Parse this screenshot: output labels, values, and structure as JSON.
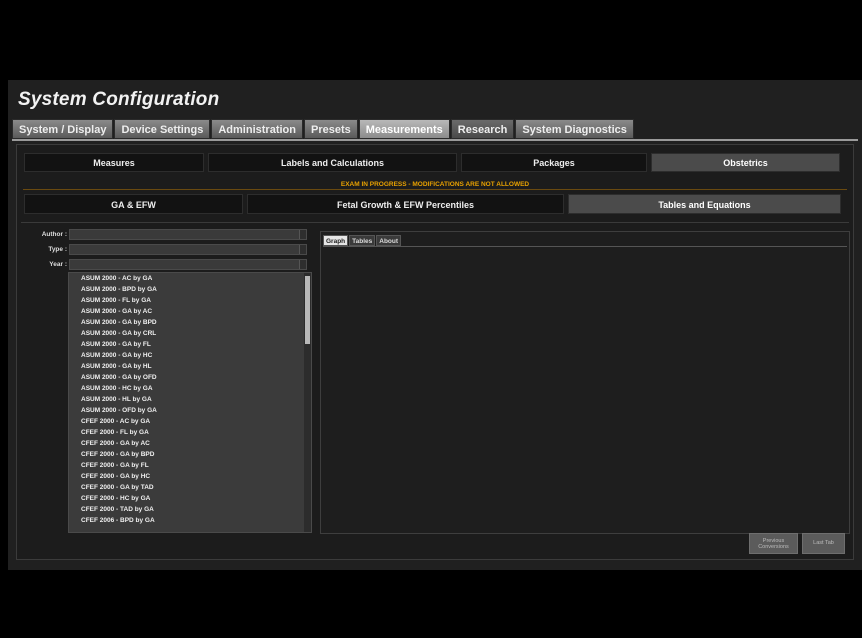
{
  "window": {
    "title": "System Configuration"
  },
  "main_tabs": [
    {
      "label": "System / Display"
    },
    {
      "label": "Device Settings"
    },
    {
      "label": "Administration"
    },
    {
      "label": "Presets"
    },
    {
      "label": "Measurements"
    },
    {
      "label": "Research"
    },
    {
      "label": "System Diagnostics"
    }
  ],
  "sub_tabs": [
    {
      "label": "Measures"
    },
    {
      "label": "Labels and Calculations"
    },
    {
      "label": "Packages"
    },
    {
      "label": "Obstetrics"
    }
  ],
  "warning": "EXAM IN PROGRESS - MODIFICATIONS ARE NOT ALLOWED",
  "ob_tabs": [
    {
      "label": "GA & EFW"
    },
    {
      "label": "Fetal Growth & EFW Percentiles"
    },
    {
      "label": "Tables and Equations"
    }
  ],
  "filters": {
    "author_label": "Author :",
    "type_label": "Type :",
    "year_label": "Year :"
  },
  "tables_list": [
    "ASUM 2000 - AC by GA",
    "ASUM 2000 - BPD by GA",
    "ASUM 2000 - FL by GA",
    "ASUM 2000 - GA by AC",
    "ASUM 2000 - GA by BPD",
    "ASUM 2000 - GA by CRL",
    "ASUM 2000 - GA by FL",
    "ASUM 2000 - GA by HC",
    "ASUM 2000 - GA by HL",
    "ASUM 2000 - GA by OFD",
    "ASUM 2000 - HC by GA",
    "ASUM 2000 - HL by GA",
    "ASUM 2000 - OFD by GA",
    "CFEF 2000 - AC by GA",
    "CFEF 2000 - FL by GA",
    "CFEF 2000 - GA by AC",
    "CFEF 2000 - GA by BPD",
    "CFEF 2000 - GA by FL",
    "CFEF 2000 - GA by HC",
    "CFEF 2000 - GA by TAD",
    "CFEF 2000 - HC by GA",
    "CFEF 2000 - TAD by GA",
    "CFEF 2006 - BPD by GA"
  ],
  "detail_tabs": [
    {
      "label": "Graph"
    },
    {
      "label": "Tables"
    },
    {
      "label": "About"
    }
  ],
  "buttons": {
    "previous": "Previous Conversions",
    "last": "Last Tab"
  },
  "colors": {
    "accent_warning": "#e8a100",
    "active_tab": "#a6a6a6",
    "panel_bg": "#1c1c1c"
  }
}
